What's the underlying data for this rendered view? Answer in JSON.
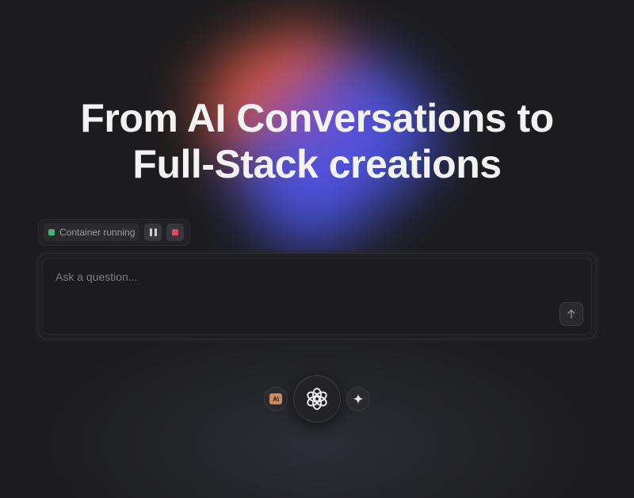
{
  "hero": {
    "line1": "From AI Conversations to",
    "line2": "Full-Stack creations"
  },
  "status": {
    "label": "Container running",
    "indicator_color": "#3fb37a",
    "pause_icon": "pause-icon",
    "stop_icon": "stop-icon",
    "stop_color": "#e4475f"
  },
  "prompt": {
    "placeholder": "Ask a question...",
    "value": "",
    "send_icon": "arrow-up-icon"
  },
  "models": {
    "left": {
      "icon": "anthropic-icon",
      "badge_text": "A\\"
    },
    "center": {
      "icon": "openai-icon",
      "selected": true
    },
    "right": {
      "icon": "sparkle-icon"
    }
  },
  "colors": {
    "background": "#1c1c1e",
    "blob_red": "#ea5e46",
    "blob_blue": "#4a55e6",
    "headline": "#f2f2f2"
  }
}
